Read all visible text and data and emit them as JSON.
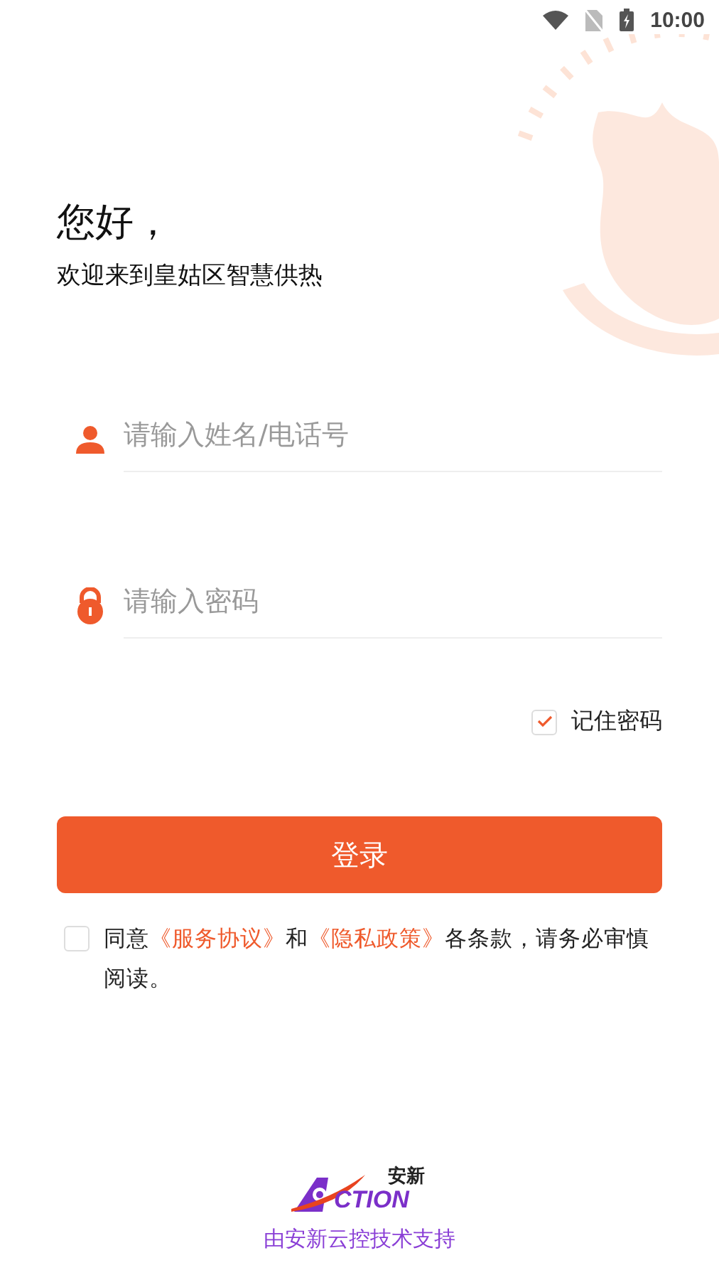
{
  "status_bar": {
    "time": "10:00"
  },
  "greeting": "您好，",
  "subtitle": "欢迎来到皇姑区智慧供热",
  "username": {
    "placeholder": "请输入姓名/电话号"
  },
  "password": {
    "placeholder": "请输入密码"
  },
  "remember": {
    "label": "记住密码",
    "checked": true
  },
  "login_button": "登录",
  "agreement": {
    "checked": false,
    "segments": [
      {
        "kind": "text",
        "text": "同意"
      },
      {
        "kind": "link",
        "text": "《服务协议》"
      },
      {
        "kind": "text",
        "text": "和"
      },
      {
        "kind": "link",
        "text": "《隐私政策》"
      },
      {
        "kind": "text",
        "text": "各条款，请务必审慎阅读。"
      }
    ]
  },
  "footer": {
    "logo_cn": "安新",
    "logo_en": "CTION",
    "support": "由安新云控技术支持"
  }
}
